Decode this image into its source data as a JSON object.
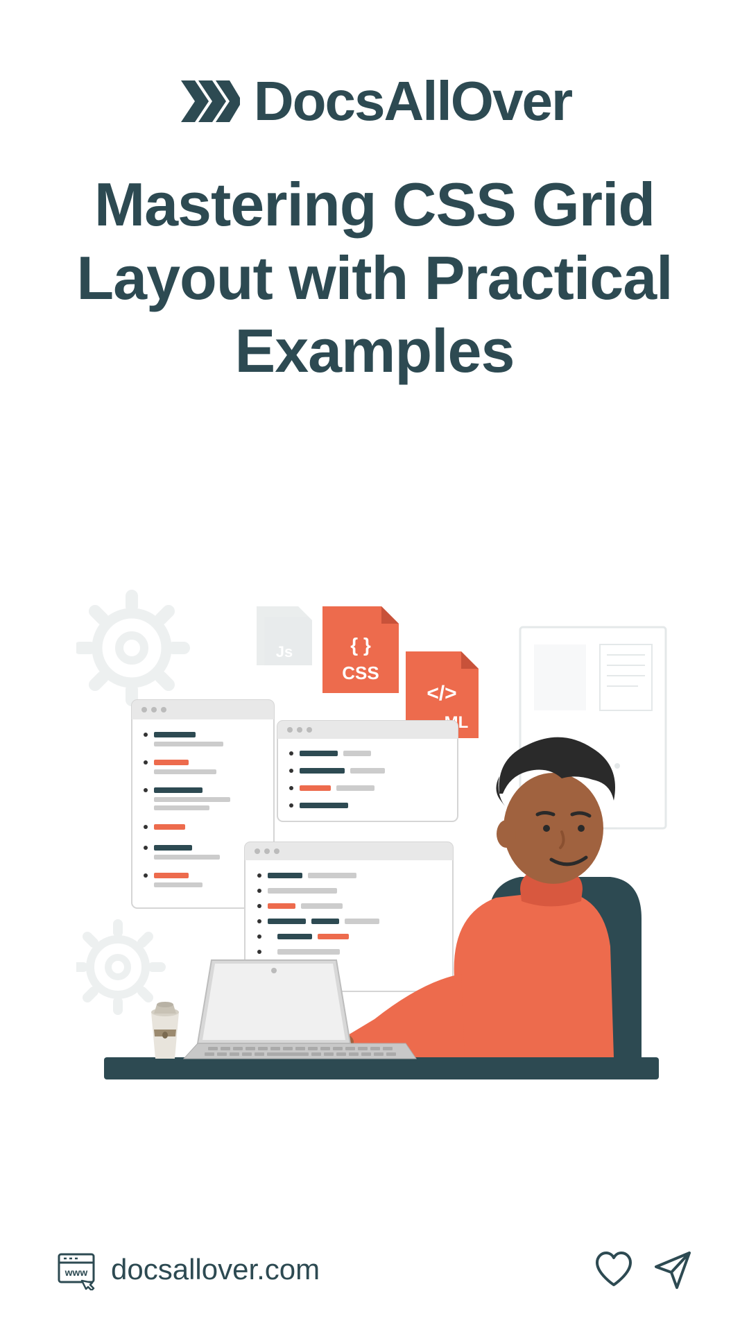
{
  "brand": "DocsAllOver",
  "title": "Mastering CSS Grid Layout with Practical Examples",
  "footer": {
    "website_text": "www",
    "url": "docsallover.com"
  },
  "illustration": {
    "css_label": "CSS",
    "html_label": "ML",
    "js_label": "Js"
  }
}
